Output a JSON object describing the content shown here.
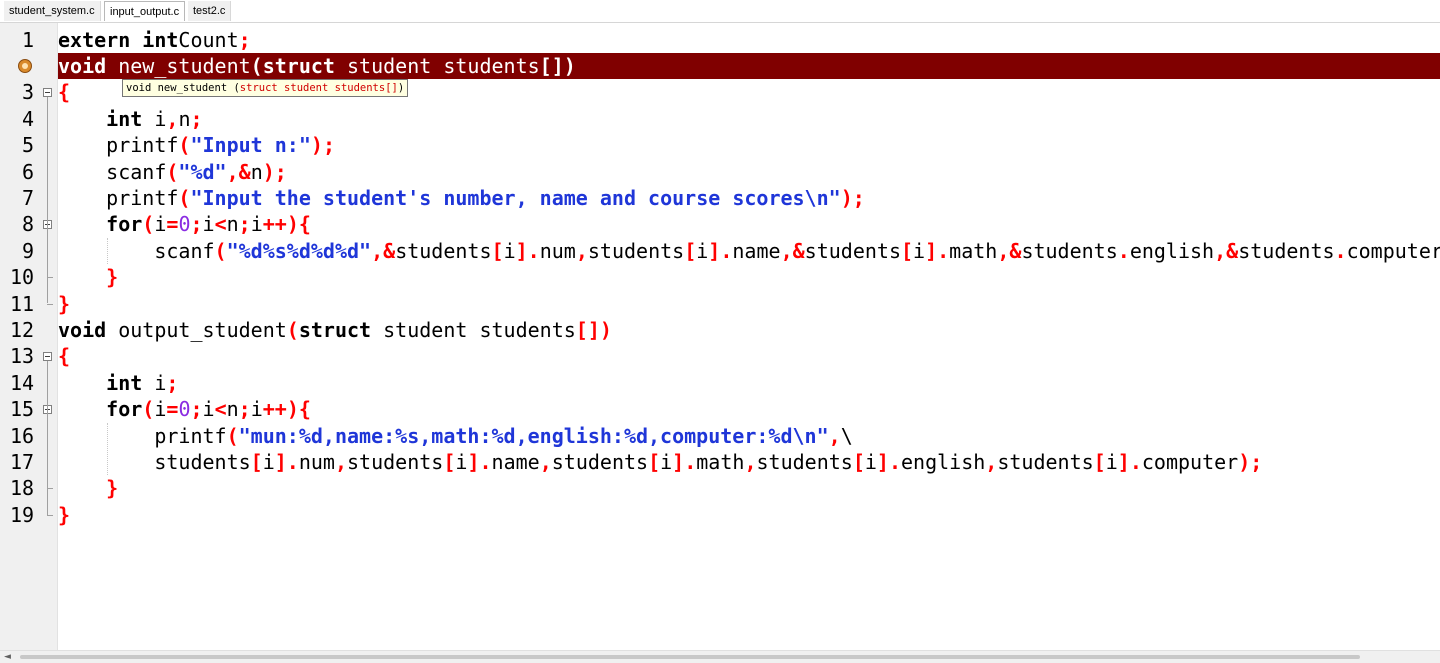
{
  "tabs": [
    {
      "label": "student_system.c",
      "active": false
    },
    {
      "label": "input_output.c",
      "active": true
    },
    {
      "label": "test2.c",
      "active": false
    }
  ],
  "editor": {
    "current_line": 2,
    "highlight_color": "#800000",
    "tooltip": {
      "prefix": "void new_student (",
      "param": "struct student students[]",
      "suffix": ")"
    },
    "lines": [
      {
        "num": "1",
        "tokens": [
          [
            "kw",
            "extern int"
          ],
          [
            "",
            "Count"
          ],
          [
            "op",
            ";"
          ]
        ]
      },
      {
        "num": "2",
        "tokens": [
          [
            "kw",
            "void"
          ],
          [
            "",
            " new_student"
          ],
          [
            "br",
            "("
          ],
          [
            "kw",
            "struct"
          ],
          [
            "",
            " student students"
          ],
          [
            "br",
            "[])"
          ]
        ]
      },
      {
        "num": "3",
        "tokens": [
          [
            "br",
            "{"
          ]
        ]
      },
      {
        "num": "4",
        "tokens": [
          [
            "",
            "    "
          ],
          [
            "kw",
            "int"
          ],
          [
            "",
            " i"
          ],
          [
            "op",
            ","
          ],
          [
            "",
            "n"
          ],
          [
            "op",
            ";"
          ]
        ]
      },
      {
        "num": "5",
        "tokens": [
          [
            "",
            "    printf"
          ],
          [
            "br",
            "("
          ],
          [
            "str",
            "\"Input n:\""
          ],
          [
            "br",
            ")"
          ],
          [
            "op",
            ";"
          ]
        ]
      },
      {
        "num": "6",
        "tokens": [
          [
            "",
            "    scanf"
          ],
          [
            "br",
            "("
          ],
          [
            "str",
            "\"%d\""
          ],
          [
            "op",
            ",&"
          ],
          [
            "",
            "n"
          ],
          [
            "br",
            ")"
          ],
          [
            "op",
            ";"
          ]
        ]
      },
      {
        "num": "7",
        "tokens": [
          [
            "",
            "    printf"
          ],
          [
            "br",
            "("
          ],
          [
            "str",
            "\"Input the student's number, name and course scores\\n\""
          ],
          [
            "br",
            ")"
          ],
          [
            "op",
            ";"
          ]
        ]
      },
      {
        "num": "8",
        "tokens": [
          [
            "",
            "    "
          ],
          [
            "kw",
            "for"
          ],
          [
            "br",
            "("
          ],
          [
            "",
            "i"
          ],
          [
            "op",
            "="
          ],
          [
            "num",
            "0"
          ],
          [
            "op",
            ";"
          ],
          [
            "",
            "i"
          ],
          [
            "op",
            "<"
          ],
          [
            "",
            "n"
          ],
          [
            "op",
            ";"
          ],
          [
            "",
            "i"
          ],
          [
            "op",
            "++"
          ],
          [
            "br",
            ")"
          ],
          [
            "br",
            "{"
          ]
        ]
      },
      {
        "num": "9",
        "tokens": [
          [
            "",
            "        scanf"
          ],
          [
            "br",
            "("
          ],
          [
            "str",
            "\"%d%s%d%d%d\""
          ],
          [
            "op",
            ",&"
          ],
          [
            "",
            "students"
          ],
          [
            "br",
            "["
          ],
          [
            "",
            "i"
          ],
          [
            "br",
            "]"
          ],
          [
            "op",
            "."
          ],
          [
            "",
            "num"
          ],
          [
            "op",
            ","
          ],
          [
            "",
            "students"
          ],
          [
            "br",
            "["
          ],
          [
            "",
            "i"
          ],
          [
            "br",
            "]"
          ],
          [
            "op",
            "."
          ],
          [
            "",
            "name"
          ],
          [
            "op",
            ",&"
          ],
          [
            "",
            "students"
          ],
          [
            "br",
            "["
          ],
          [
            "",
            "i"
          ],
          [
            "br",
            "]"
          ],
          [
            "op",
            "."
          ],
          [
            "",
            "math"
          ],
          [
            "op",
            ",&"
          ],
          [
            "",
            "students"
          ],
          [
            "op",
            "."
          ],
          [
            "",
            "english"
          ],
          [
            "op",
            ",&"
          ],
          [
            "",
            "students"
          ],
          [
            "op",
            "."
          ],
          [
            "",
            "computer"
          ]
        ]
      },
      {
        "num": "10",
        "tokens": [
          [
            "",
            "    "
          ],
          [
            "br",
            "}"
          ]
        ]
      },
      {
        "num": "11",
        "tokens": [
          [
            "br",
            "}"
          ]
        ]
      },
      {
        "num": "12",
        "tokens": [
          [
            "kw",
            "void"
          ],
          [
            "",
            " output_student"
          ],
          [
            "br",
            "("
          ],
          [
            "kw",
            "struct"
          ],
          [
            "",
            " student students"
          ],
          [
            "br",
            "[])"
          ]
        ]
      },
      {
        "num": "13",
        "tokens": [
          [
            "br",
            "{"
          ]
        ]
      },
      {
        "num": "14",
        "tokens": [
          [
            "",
            "    "
          ],
          [
            "kw",
            "int"
          ],
          [
            "",
            " i"
          ],
          [
            "op",
            ";"
          ]
        ]
      },
      {
        "num": "15",
        "tokens": [
          [
            "",
            "    "
          ],
          [
            "kw",
            "for"
          ],
          [
            "br",
            "("
          ],
          [
            "",
            "i"
          ],
          [
            "op",
            "="
          ],
          [
            "num",
            "0"
          ],
          [
            "op",
            ";"
          ],
          [
            "",
            "i"
          ],
          [
            "op",
            "<"
          ],
          [
            "",
            "n"
          ],
          [
            "op",
            ";"
          ],
          [
            "",
            "i"
          ],
          [
            "op",
            "++"
          ],
          [
            "br",
            ")"
          ],
          [
            "br",
            "{"
          ]
        ]
      },
      {
        "num": "16",
        "tokens": [
          [
            "",
            "        printf"
          ],
          [
            "br",
            "("
          ],
          [
            "str",
            "\"mun:%d,name:%s,math:%d,english:%d,computer:%d\\n\""
          ],
          [
            "op",
            ","
          ],
          [
            "",
            "\\"
          ]
        ]
      },
      {
        "num": "17",
        "tokens": [
          [
            "",
            "        students"
          ],
          [
            "br",
            "["
          ],
          [
            "",
            "i"
          ],
          [
            "br",
            "]"
          ],
          [
            "op",
            "."
          ],
          [
            "",
            "num"
          ],
          [
            "op",
            ","
          ],
          [
            "",
            "students"
          ],
          [
            "br",
            "["
          ],
          [
            "",
            "i"
          ],
          [
            "br",
            "]"
          ],
          [
            "op",
            "."
          ],
          [
            "",
            "name"
          ],
          [
            "op",
            ","
          ],
          [
            "",
            "students"
          ],
          [
            "br",
            "["
          ],
          [
            "",
            "i"
          ],
          [
            "br",
            "]"
          ],
          [
            "op",
            "."
          ],
          [
            "",
            "math"
          ],
          [
            "op",
            ","
          ],
          [
            "",
            "students"
          ],
          [
            "br",
            "["
          ],
          [
            "",
            "i"
          ],
          [
            "br",
            "]"
          ],
          [
            "op",
            "."
          ],
          [
            "",
            "english"
          ],
          [
            "op",
            ","
          ],
          [
            "",
            "students"
          ],
          [
            "br",
            "["
          ],
          [
            "",
            "i"
          ],
          [
            "br",
            "]"
          ],
          [
            "op",
            "."
          ],
          [
            "",
            "computer"
          ],
          [
            "br",
            ")"
          ],
          [
            "op",
            ";"
          ]
        ]
      },
      {
        "num": "18",
        "tokens": [
          [
            "",
            "    "
          ],
          [
            "br",
            "}"
          ]
        ]
      },
      {
        "num": "19",
        "tokens": [
          [
            "br",
            "}"
          ]
        ]
      }
    ]
  },
  "scrollbar": {
    "left_arrow": "◄"
  }
}
